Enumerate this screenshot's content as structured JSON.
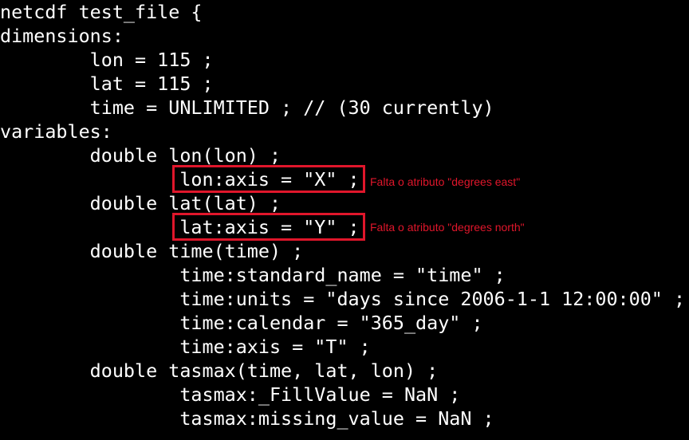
{
  "terminal": {
    "lines": [
      "netcdf test_file {",
      "dimensions:",
      "        lon = 115 ;",
      "        lat = 115 ;",
      "        time = UNLIMITED ; // (30 currently)",
      "variables:",
      "        double lon(lon) ;",
      "                lon:axis = \"X\" ;",
      "        double lat(lat) ;",
      "                lat:axis = \"Y\" ;",
      "        double time(time) ;",
      "                time:standard_name = \"time\" ;",
      "                time:units = \"days since 2006-1-1 12:00:00\" ;",
      "                time:calendar = \"365_day\" ;",
      "                time:axis = \"T\" ;",
      "        double tasmax(time, lat, lon) ;",
      "                tasmax:_FillValue = NaN ;",
      "                tasmax:missing_value = NaN ;"
    ]
  },
  "annotations": {
    "lon_note": "Falta o atributo \"degrees east\"",
    "lat_note": "Falta o atributo \"degrees north\"",
    "color": "#e0162b"
  }
}
